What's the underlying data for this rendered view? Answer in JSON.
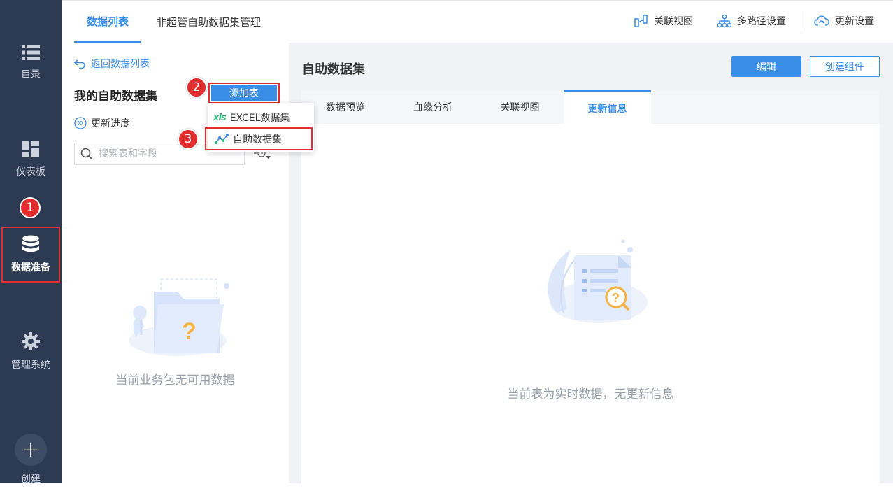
{
  "sidebar": {
    "items": [
      {
        "label": "目录",
        "icon": "list-icon"
      },
      {
        "label": "仪表板",
        "icon": "dashboard-icon"
      },
      {
        "label": "数据准备",
        "icon": "database-icon"
      },
      {
        "label": "管理系统",
        "icon": "gear-icon"
      },
      {
        "label": "创建",
        "icon": "plus-icon"
      }
    ]
  },
  "badges": {
    "one": "1",
    "two": "2",
    "three": "3"
  },
  "topbar": {
    "tabs": [
      {
        "label": "数据列表",
        "active": true
      },
      {
        "label": "非超管自助数据集管理",
        "active": false
      }
    ],
    "actions": [
      {
        "label": "关联视图",
        "icon": "relation-view-icon"
      },
      {
        "label": "多路径设置",
        "icon": "multipath-icon"
      },
      {
        "label": "更新设置",
        "icon": "cloud-refresh-icon"
      }
    ]
  },
  "left": {
    "back_label": "返回数据列表",
    "title": "我的自助数据集",
    "add_label": "添加表",
    "progress_label": "更新进度",
    "search_placeholder": "搜索表和字段",
    "dropdown": [
      {
        "label": "EXCEL数据集",
        "icon": "xls-icon"
      },
      {
        "label": "自助数据集",
        "icon": "self-dataset-icon"
      }
    ],
    "empty_text": "当前业务包无可用数据"
  },
  "right": {
    "title": "自助数据集",
    "edit_label": "编辑",
    "create_label": "创建组件",
    "tabs": [
      {
        "label": "数据预览",
        "active": false
      },
      {
        "label": "血缘分析",
        "active": false
      },
      {
        "label": "关联视图",
        "active": false
      },
      {
        "label": "更新信息",
        "active": true
      }
    ],
    "empty_text": "当前表为实时数据，无更新信息"
  },
  "colors": {
    "accent": "#3a8ee6",
    "sidebar": "#2c3a52",
    "highlight": "#e02d2d"
  }
}
